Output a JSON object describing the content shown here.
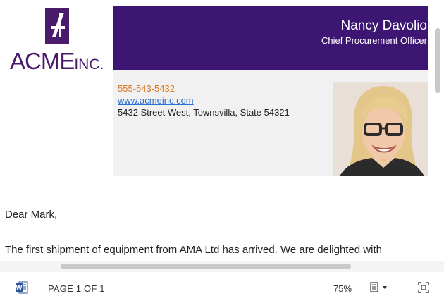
{
  "logo": {
    "main": "ACME",
    "suffix": "INC.",
    "brand_color": "#4a1a6b"
  },
  "header": {
    "name": "Nancy Davolio",
    "role": "Chief Procurement Officer",
    "banner_color": "#3d1673"
  },
  "contact": {
    "phone": "555-543-5432",
    "website": "www.acmeinc.com",
    "address": "5432 Street West, Townsvilla, State 54321",
    "phone_color": "#d97a1f",
    "link_color": "#2a6fd1"
  },
  "body": {
    "greeting": "Dear Mark,",
    "paragraph": "The first shipment of equipment from AMA Ltd has arrived. We are delighted with"
  },
  "statusbar": {
    "app_icon": "word-icon",
    "page_indicator": "PAGE 1 OF 1",
    "zoom": "75%",
    "view_icon": "document-view-icon",
    "fit_icon": "fit-to-window-icon"
  }
}
